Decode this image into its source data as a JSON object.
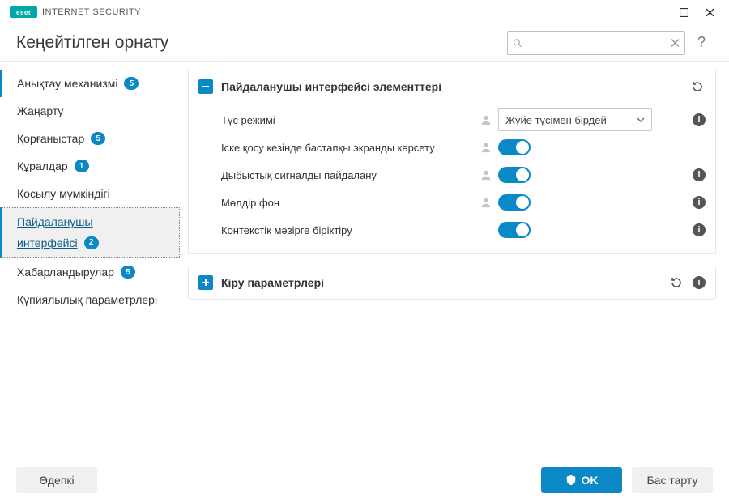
{
  "brand": {
    "logo": "eset",
    "product": "INTERNET SECURITY"
  },
  "header": {
    "title": "Кеңейтілген орнату"
  },
  "search": {
    "placeholder": ""
  },
  "sidebar": {
    "items": [
      {
        "label": "Анықтау механизмі",
        "badge": "5"
      },
      {
        "label": "Жаңарту",
        "badge": null
      },
      {
        "label": "Қорғаныстар",
        "badge": "5"
      },
      {
        "label": "Құралдар",
        "badge": "1"
      },
      {
        "label": "Қосылу мүмкіндігі",
        "badge": null
      },
      {
        "label_line1": "Пайдаланушы",
        "label_line2": "интерфейсі",
        "badge": "2"
      },
      {
        "label": "Хабарландырулар",
        "badge": "5"
      },
      {
        "label": "Құпиялылық параметрлері",
        "badge": null
      }
    ]
  },
  "panels": {
    "ui_elements": {
      "title": "Пайдаланушы интерфейсі элементтері",
      "rows": {
        "color_mode": {
          "label": "Түс режимі",
          "value": "Жүйе түсімен бірдей"
        },
        "splash": {
          "label": "Іске қосу кезінде бастапқы экранды көрсету"
        },
        "sound": {
          "label": "Дыбыстық сигналды пайдалану"
        },
        "transparent": {
          "label": "Мөлдір фон"
        },
        "context": {
          "label": "Контекстік мәзірге біріктіру"
        }
      }
    },
    "login": {
      "title": "Кіру параметрлері"
    }
  },
  "footer": {
    "default": "Әдепкі",
    "ok": "OK",
    "cancel": "Бас тарту"
  }
}
